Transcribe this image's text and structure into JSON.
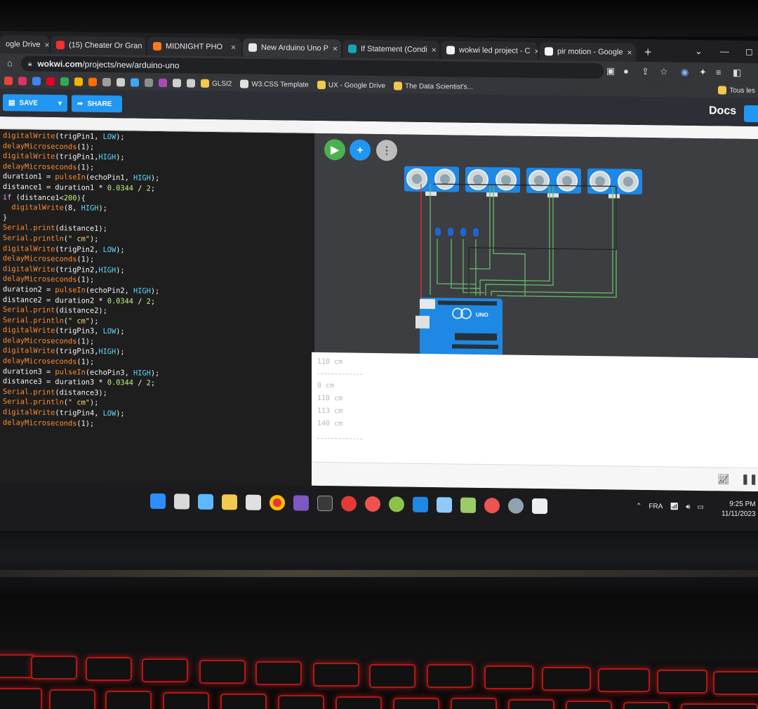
{
  "browser": {
    "tabs": [
      {
        "title": "ogle Drive",
        "favicon_color": "#f2c94c",
        "active": false
      },
      {
        "title": "(15) Cheater Or Gran",
        "favicon_color": "#ff2d2d",
        "active": false
      },
      {
        "title": "MIDNIGHT PHO",
        "favicon_color": "#ff7a1a",
        "active": false
      },
      {
        "title": "New Arduino Uno P",
        "favicon_color": "#e8e8e8",
        "active": true
      },
      {
        "title": "If Statement (Condi",
        "favicon_color": "#16a6b6",
        "active": false
      },
      {
        "title": "wokwi led project - C",
        "favicon_color": "#f2f2f2",
        "active": false
      },
      {
        "title": "pir motion - Google",
        "favicon_color": "#f2f2f2",
        "active": false
      }
    ],
    "new_tab": "+",
    "url_domain": "wokwi.com",
    "url_path": "/projects/new/arduino-uno",
    "bookmarks": [
      {
        "label": "GLSI2",
        "icon_color": "#f2c94c"
      },
      {
        "label": "W3.CSS Template",
        "icon_color": "#e0e0e0"
      },
      {
        "label": "UX - Google Drive",
        "icon_color": "#f2c94c"
      },
      {
        "label": "The Data Scientist's...",
        "icon_color": "#f2c94c"
      }
    ],
    "bookmarks_right": "Tous les"
  },
  "wokwi": {
    "save_label": "SAVE",
    "share_label": "SHARE",
    "docs_label": "Docs",
    "accent": "#2196f3"
  },
  "code_lines": [
    [
      [
        "fn",
        "digitalWrite"
      ],
      [
        "var",
        "(trigPin1, "
      ],
      [
        "cst",
        "LOW"
      ],
      [
        "var",
        ");"
      ]
    ],
    [
      [
        "fn",
        "delayMicroseconds"
      ],
      [
        "var",
        "(1);"
      ]
    ],
    [
      [
        "fn",
        "digitalWrite"
      ],
      [
        "var",
        "(trigPin1,"
      ],
      [
        "cst",
        "HIGH"
      ],
      [
        "var",
        ");"
      ]
    ],
    [
      [
        "fn",
        "delayMicroseconds"
      ],
      [
        "var",
        "(1);"
      ]
    ],
    [
      [
        "var",
        "duration1 = "
      ],
      [
        "fn",
        "pulseIn"
      ],
      [
        "var",
        "(echoPin1, "
      ],
      [
        "cst",
        "HIGH"
      ],
      [
        "var",
        ");"
      ]
    ],
    [
      [
        "var",
        "distance1 = duration1 * "
      ],
      [
        "num",
        "0.0344"
      ],
      [
        "var",
        " / "
      ],
      [
        "num",
        "2"
      ],
      [
        "var",
        ";"
      ]
    ],
    [
      [
        "kw",
        "if"
      ],
      [
        "var",
        " (distance1<"
      ],
      [
        "num",
        "200"
      ],
      [
        "var",
        "){"
      ]
    ],
    [
      [
        "var",
        "  "
      ],
      [
        "fn",
        "digitalWrite"
      ],
      [
        "var",
        "(8, "
      ],
      [
        "cst",
        "HIGH"
      ],
      [
        "var",
        ");"
      ]
    ],
    [
      [
        "var",
        "}"
      ]
    ],
    [
      [
        "fn",
        "Serial.print"
      ],
      [
        "var",
        "(distance1);"
      ]
    ],
    [
      [
        "fn",
        "Serial.println"
      ],
      [
        "var",
        "("
      ],
      [
        "str",
        "\" cm\""
      ],
      [
        "var",
        ");"
      ]
    ],
    [
      [
        "var",
        ""
      ]
    ],
    [
      [
        "fn",
        "digitalWrite"
      ],
      [
        "var",
        "(trigPin2, "
      ],
      [
        "cst",
        "LOW"
      ],
      [
        "var",
        ");"
      ]
    ],
    [
      [
        "fn",
        "delayMicroseconds"
      ],
      [
        "var",
        "(1);"
      ]
    ],
    [
      [
        "fn",
        "digitalWrite"
      ],
      [
        "var",
        "(trigPin2,"
      ],
      [
        "cst",
        "HIGH"
      ],
      [
        "var",
        ");"
      ]
    ],
    [
      [
        "fn",
        "delayMicroseconds"
      ],
      [
        "var",
        "(1);"
      ]
    ],
    [
      [
        "var",
        "duration2 = "
      ],
      [
        "fn",
        "pulseIn"
      ],
      [
        "var",
        "(echoPin2, "
      ],
      [
        "cst",
        "HIGH"
      ],
      [
        "var",
        ");"
      ]
    ],
    [
      [
        "var",
        "distance2 = duration2 * "
      ],
      [
        "num",
        "0.0344"
      ],
      [
        "var",
        " / "
      ],
      [
        "num",
        "2"
      ],
      [
        "var",
        ";"
      ]
    ],
    [
      [
        "fn",
        "Serial.print"
      ],
      [
        "var",
        "(distance2);"
      ]
    ],
    [
      [
        "fn",
        "Serial.println"
      ],
      [
        "var",
        "("
      ],
      [
        "str",
        "\" cm\""
      ],
      [
        "var",
        ");"
      ]
    ],
    [
      [
        "var",
        ""
      ]
    ],
    [
      [
        "fn",
        "digitalWrite"
      ],
      [
        "var",
        "(trigPin3, "
      ],
      [
        "cst",
        "LOW"
      ],
      [
        "var",
        ");"
      ]
    ],
    [
      [
        "fn",
        "delayMicroseconds"
      ],
      [
        "var",
        "(1);"
      ]
    ],
    [
      [
        "fn",
        "digitalWrite"
      ],
      [
        "var",
        "(trigPin3,"
      ],
      [
        "cst",
        "HIGH"
      ],
      [
        "var",
        ");"
      ]
    ],
    [
      [
        "fn",
        "delayMicroseconds"
      ],
      [
        "var",
        "(1);"
      ]
    ],
    [
      [
        "var",
        "duration3 = "
      ],
      [
        "fn",
        "pulseIn"
      ],
      [
        "var",
        "(echoPin3, "
      ],
      [
        "cst",
        "HIGH"
      ],
      [
        "var",
        ");"
      ]
    ],
    [
      [
        "var",
        "distance3 = duration3 * "
      ],
      [
        "num",
        "0.0344"
      ],
      [
        "var",
        " / "
      ],
      [
        "num",
        "2"
      ],
      [
        "var",
        ";"
      ]
    ],
    [
      [
        "fn",
        "Serial.print"
      ],
      [
        "var",
        "(distance3);"
      ]
    ],
    [
      [
        "fn",
        "Serial.println"
      ],
      [
        "var",
        "("
      ],
      [
        "str",
        "\" cm\""
      ],
      [
        "var",
        ");"
      ]
    ],
    [
      [
        "var",
        ""
      ]
    ],
    [
      [
        "fn",
        "digitalWrite"
      ],
      [
        "var",
        "(trigPin4, "
      ],
      [
        "cst",
        "LOW"
      ],
      [
        "var",
        ");"
      ]
    ],
    [
      [
        "fn",
        "delayMicroseconds"
      ],
      [
        "var",
        "(1);"
      ]
    ]
  ],
  "serial_monitor": {
    "lines": [
      "110 cm",
      "0 cm",
      "110 cm",
      "113 cm",
      "140 cm"
    ]
  },
  "sim": {
    "run_color": "#4caf50",
    "add_color": "#2196f3",
    "menu_color": "#bdbdbd",
    "sensor_count": 4,
    "led_count": 4,
    "board_label": "UNO"
  },
  "system": {
    "language": "FRA",
    "time": "9:25 PM",
    "date": "11/11/2023"
  }
}
